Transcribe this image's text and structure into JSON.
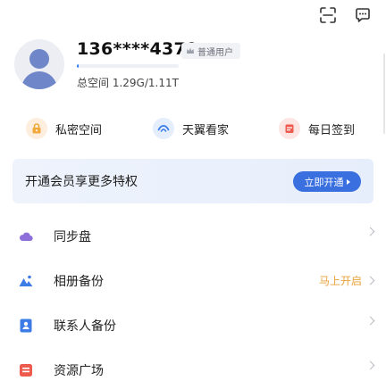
{
  "header": {
    "icons": [
      "scan-icon",
      "message-icon"
    ]
  },
  "profile": {
    "phone": "136****4379",
    "badge_label": "普通用户",
    "storage_text": "总空间 1.29G/1.11T",
    "storage_fraction": 0.02
  },
  "quick_actions": [
    {
      "label": "私密空间",
      "icon": "lock-icon",
      "color": "#f2a93b",
      "bg": "#fdeedd"
    },
    {
      "label": "天翼看家",
      "icon": "eye-icon",
      "color": "#3c7ce8",
      "bg": "#e4eefc"
    },
    {
      "label": "每日签到",
      "icon": "calendar-icon",
      "color": "#ef5a4f",
      "bg": "#fde5e3"
    }
  ],
  "vip_banner": {
    "text": "开通会员享更多特权",
    "button_label": "立即开通"
  },
  "menu": [
    {
      "label": "同步盘",
      "icon": "cloud-icon",
      "status": ""
    },
    {
      "label": "相册备份",
      "icon": "photo-icon",
      "status": "马上开启"
    },
    {
      "label": "联系人备份",
      "icon": "contact-icon",
      "status": ""
    },
    {
      "label": "资源广场",
      "icon": "resource-icon",
      "status": ""
    }
  ],
  "colors": {
    "accent": "#3a6fe0",
    "status": "#e8a33a"
  }
}
